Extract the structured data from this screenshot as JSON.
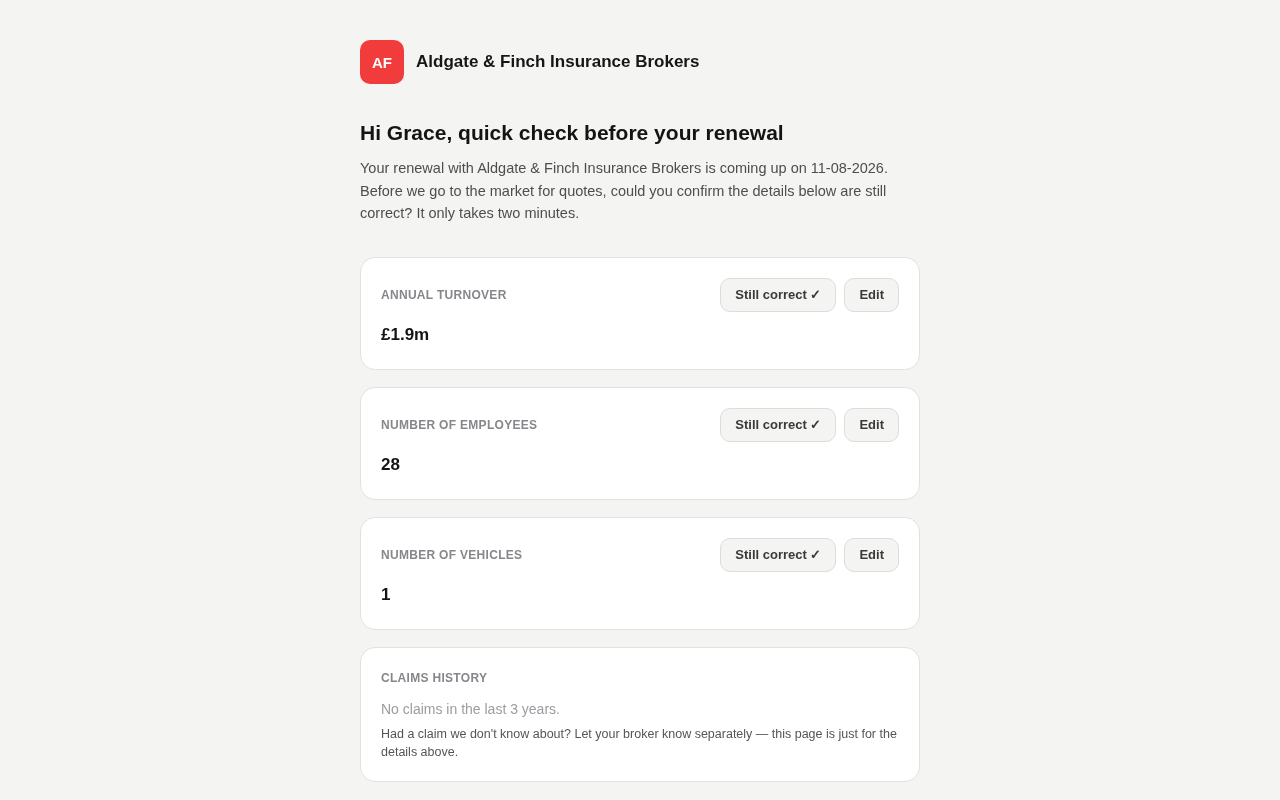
{
  "brand": {
    "logo_text": "AF",
    "name": "Aldgate & Finch Insurance Brokers"
  },
  "heading": "Hi Grace, quick check before your renewal",
  "intro": "Your renewal with Aldgate & Finch Insurance Brokers is coming up on 11-08-2026. Before we go to the market for quotes, could you confirm the details below are still correct? It only takes two minutes.",
  "details": [
    {
      "label": "ANNUAL TURNOVER",
      "value": "£1.9m",
      "actions": [
        "Still correct ✓",
        "Edit"
      ]
    },
    {
      "label": "NUMBER OF EMPLOYEES",
      "value": "28",
      "actions": [
        "Still correct ✓",
        "Edit"
      ]
    },
    {
      "label": "NUMBER OF VEHICLES",
      "value": "1",
      "actions": [
        "Still correct ✓",
        "Edit"
      ]
    }
  ],
  "claims": {
    "label": "CLAIMS HISTORY",
    "summary": "No claims in the last 3 years.",
    "note": "Had a claim we don't know about? Let your broker know separately — this page is just for the details above."
  }
}
